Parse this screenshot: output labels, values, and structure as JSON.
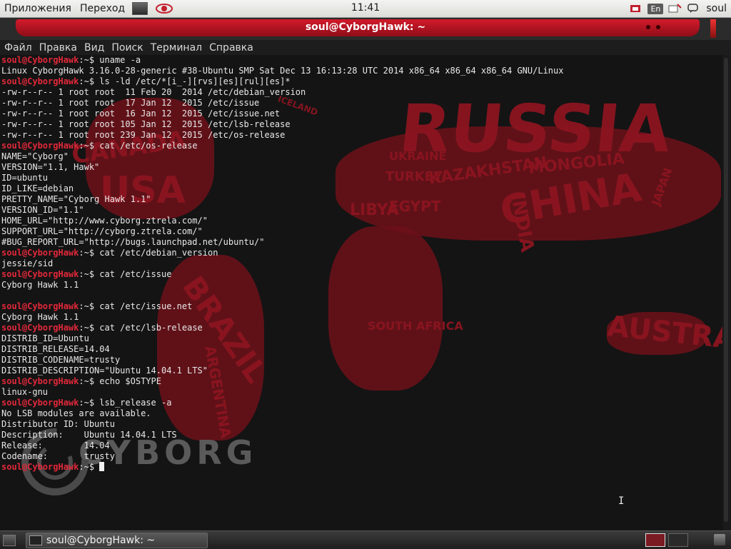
{
  "top_panel": {
    "menus": [
      "Приложения",
      "Переход"
    ],
    "clock": "11:41",
    "lang": "En",
    "user": "soul"
  },
  "window": {
    "title": "soul@CyborgHawk: ~"
  },
  "menubar": [
    "Файл",
    "Правка",
    "Вид",
    "Поиск",
    "Терминал",
    "Справка"
  ],
  "terminal": {
    "prompt_user": "soul@CyborgHawk",
    "prompt_suffix": ":~$ ",
    "lines": [
      {
        "type": "cmd",
        "text": "uname -a"
      },
      {
        "type": "out",
        "text": "Linux CyborgHawk 3.16.0-28-generic #38-Ubuntu SMP Sat Dec 13 16:13:28 UTC 2014 x86_64 x86_64 x86_64 GNU/Linux"
      },
      {
        "type": "cmd",
        "text": "ls -ld /etc/*[i_-][rvs][es][rul][es]*"
      },
      {
        "type": "out",
        "text": "-rw-r--r-- 1 root root  11 Feb 20  2014 /etc/debian_version"
      },
      {
        "type": "out",
        "text": "-rw-r--r-- 1 root root  17 Jan 12  2015 /etc/issue"
      },
      {
        "type": "out",
        "text": "-rw-r--r-- 1 root root  16 Jan 12  2015 /etc/issue.net"
      },
      {
        "type": "out",
        "text": "-rw-r--r-- 1 root root 105 Jan 12  2015 /etc/lsb-release"
      },
      {
        "type": "out",
        "text": "-rw-r--r-- 1 root root 239 Jan 12  2015 /etc/os-release"
      },
      {
        "type": "cmd",
        "text": "cat /etc/os-release"
      },
      {
        "type": "out",
        "text": "NAME=\"Cyborg\""
      },
      {
        "type": "out",
        "text": "VERSION=\"1.1, Hawk\""
      },
      {
        "type": "out",
        "text": "ID=ubuntu"
      },
      {
        "type": "out",
        "text": "ID_LIKE=debian"
      },
      {
        "type": "out",
        "text": "PRETTY_NAME=\"Cyborg Hawk 1.1\""
      },
      {
        "type": "out",
        "text": "VERSION_ID=\"1.1\""
      },
      {
        "type": "out",
        "text": "HOME_URL=\"http://www.cyborg.ztrela.com/\""
      },
      {
        "type": "out",
        "text": "SUPPORT_URL=\"http://cyborg.ztrela.com/\""
      },
      {
        "type": "out",
        "text": "#BUG_REPORT_URL=\"http://bugs.launchpad.net/ubuntu/\""
      },
      {
        "type": "cmd",
        "text": "cat /etc/debian_version"
      },
      {
        "type": "out",
        "text": "jessie/sid"
      },
      {
        "type": "cmd",
        "text": "cat /etc/issue"
      },
      {
        "type": "out",
        "text": "Cyborg Hawk 1.1"
      },
      {
        "type": "out",
        "text": ""
      },
      {
        "type": "cmd",
        "text": "cat /etc/issue.net"
      },
      {
        "type": "out",
        "text": "Cyborg Hawk 1.1"
      },
      {
        "type": "cmd",
        "text": "cat /etc/lsb-release"
      },
      {
        "type": "out",
        "text": "DISTRIB_ID=Ubuntu"
      },
      {
        "type": "out",
        "text": "DISTRIB_RELEASE=14.04"
      },
      {
        "type": "out",
        "text": "DISTRIB_CODENAME=trusty"
      },
      {
        "type": "out",
        "text": "DISTRIB_DESCRIPTION=\"Ubuntu 14.04.1 LTS\""
      },
      {
        "type": "cmd",
        "text": "echo $OSTYPE"
      },
      {
        "type": "out",
        "text": "linux-gnu"
      },
      {
        "type": "cmd",
        "text": "lsb_release -a"
      },
      {
        "type": "out",
        "text": "No LSB modules are available."
      },
      {
        "type": "out",
        "text": "Distributor ID:\tUbuntu"
      },
      {
        "type": "out",
        "text": "Description:\tUbuntu 14.04.1 LTS"
      },
      {
        "type": "out",
        "text": "Release:\t14.04"
      },
      {
        "type": "out",
        "text": "Codename:\ttrusty"
      },
      {
        "type": "cmd",
        "text": ""
      }
    ]
  },
  "wallpaper": {
    "words": [
      "RUSSIA",
      "USA",
      "CANADA",
      "CHINA",
      "BRAZIL",
      "AUSTRALIA",
      "MONGOLIA",
      "KAZAKHSTAN",
      "LIBYA",
      "EGYPT",
      "ARGENTINA",
      "SOUTH AFRICA",
      "INDIA",
      "TURKEY",
      "ICELAND",
      "JAPAN",
      "UKRAINE"
    ],
    "logo": "CYBORG"
  },
  "taskbar": {
    "task_label": "soul@CyborgHawk: ~"
  }
}
